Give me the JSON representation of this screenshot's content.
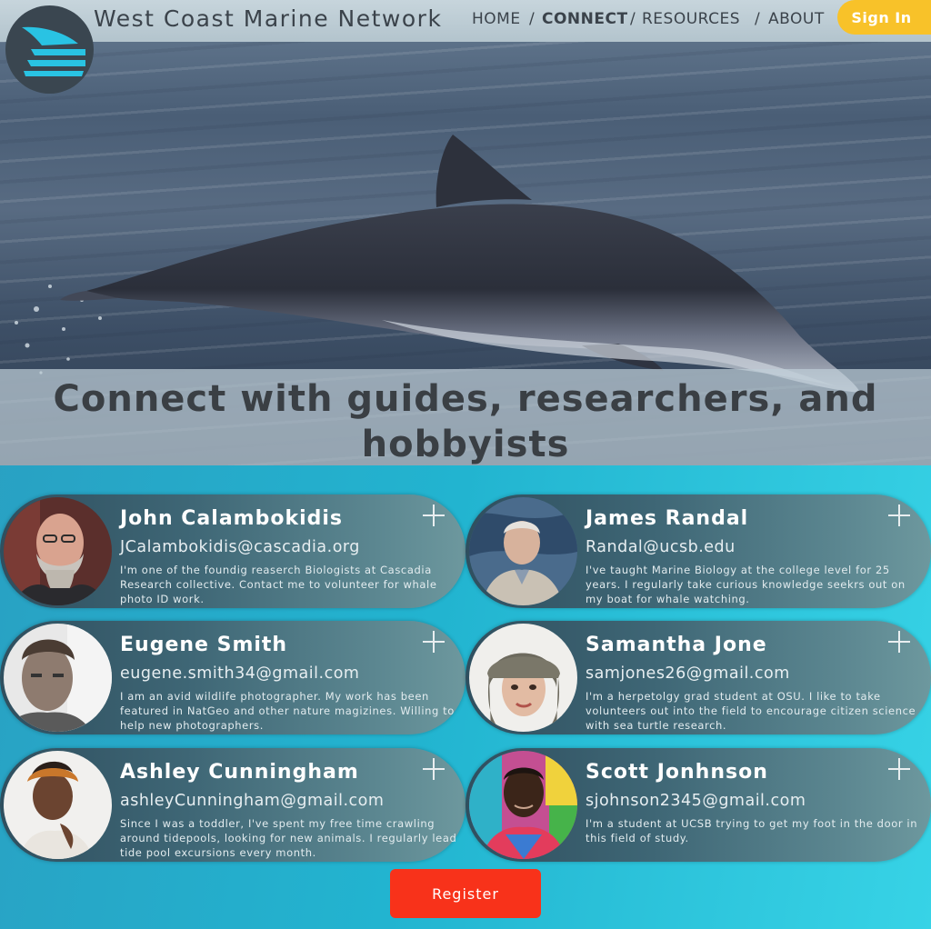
{
  "brand": {
    "name": "West Coast Marine Network",
    "logo_icon": "sail-wave-logo-icon"
  },
  "nav": {
    "items": [
      {
        "label": "HOME",
        "active": false
      },
      {
        "label": "CONNECT",
        "active": true
      },
      {
        "label": "RESOURCES",
        "active": false
      },
      {
        "label": "ABOUT",
        "active": false
      }
    ],
    "separator": "/",
    "signin_label": "Sign In"
  },
  "hero": {
    "image": "dolphin-leaping-photo",
    "title": "Connect with guides, researchers, and hobbyists"
  },
  "profiles": [
    {
      "name": "John Calambokidis",
      "email": "JCalambokidis@cascadia.org",
      "bio": "I'm one of the foundig reaserch Biologists at Cascadia Research collective.  Contact me to volunteer for whale photo ID work.",
      "add_icon": "plus-icon"
    },
    {
      "name": "James Randal",
      "email": "Randal@ucsb.edu",
      "bio": "I've taught Marine Biology at the college level for 25 years. I regularly take curious knowledge seekrs out on my boat for whale watching.",
      "add_icon": "plus-icon"
    },
    {
      "name": "Eugene Smith",
      "email": "eugene.smith34@gmail.com",
      "bio": "I am an avid wildlife photographer. My work has been featured in NatGeo and other nature magizines. Willing to help new photographers.",
      "add_icon": "plus-icon"
    },
    {
      "name": "Samantha Jone",
      "email": "samjones26@gmail.com",
      "bio": "I'm a herpetolgy grad student at OSU. I like to take volunteers out into the field to encourage citizen science with sea turtle research.",
      "add_icon": "plus-icon"
    },
    {
      "name": "Ashley Cunningham",
      "email": "ashleyCunningham@gmail.com",
      "bio": "Since I was a toddler, I've spent my free time crawling around tidepools, looking for new animals. I regularly lead tide pool excursions every month.",
      "add_icon": "plus-icon"
    },
    {
      "name": "Scott Jonhnson",
      "email": "sjohnson2345@gmail.com",
      "bio": "I'm a student at UCSB trying to get my foot in the door in this field of study.",
      "add_icon": "plus-icon"
    }
  ],
  "register_label": "Register",
  "colors": {
    "signin": "#f8c229",
    "register": "#f8321a",
    "page_background": "#22b4d0",
    "card": "#3e6675"
  }
}
